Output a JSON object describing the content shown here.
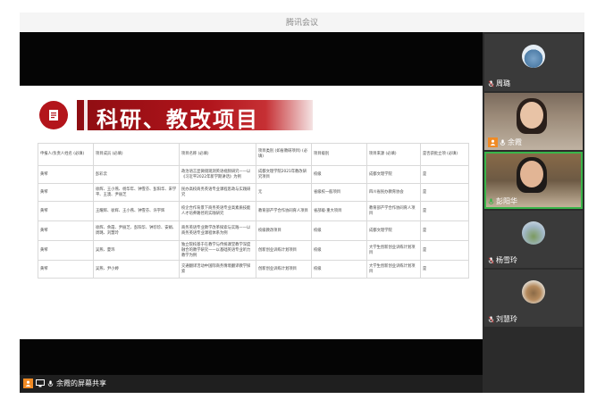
{
  "window": {
    "title": "腾讯会议"
  },
  "slide": {
    "title": "科研、教改项目",
    "table": {
      "headers": [
        "申报人/负责人姓名 (必填)",
        "项目成员 (必填)",
        "项目名称 (必填)",
        "项目类别 (如省教研项目) (必填)",
        "项目级别",
        "项目来源 (必填)",
        "是否获批立项 (必填)"
      ],
      "rows": [
        [
          "黄琴",
          "彭彩云",
          "政治语言显微镜观测英语视频研究——以《习近平2022年新学期讲话》为例",
          "成都文理学院2021年教改研究项目",
          "校级",
          "成都文理学院",
          "是"
        ],
        [
          "黄琴",
          "徐辉、王小燕、杨华年、钟雪芬、彭阳华、宋学平、王澳、尹丽芝",
          "民办高校商务英语专业课程思政与实践研究",
          "无",
          "省级校一般项目",
          "四川省民办教育协会",
          "是"
        ],
        [
          "黄琴",
          "王耀辉、徐辉、王小燕、钟雪芬、许宇辉",
          "校企合作背景下商务英语专业高素质技能人才培养路径的实践研究",
          "教育部产学合作协同育人项目",
          "省部级·重大项目",
          "教育部产学合作协同育人项目",
          "是"
        ],
        [
          "黄琴",
          "徐辉、余霞、尹丽芝、彭阳华、钟珍珍、安娟、周璐、刘慧玲",
          "商务英语专业教学改革探索与实践——以商务英语专业课程体系为例",
          "校级教改项目",
          "校级",
          "成都文理学院",
          "是"
        ],
        [
          "黄琴",
          "吴燕、夏玮",
          "独立院校基于在教学与传统课堂教学深度融合的教学研究——以基础英语专业听力教学为例",
          "创新创业训练计划项目",
          "校级",
          "大学生创新创业训练计划项目",
          "是"
        ],
        [
          "黄琴",
          "吴燕、尹小婷",
          "交通翻译活动中国际商务情境翻译教学探索",
          "创新创业训练计划项目",
          "校级",
          "大学生创新创业训练计划项目",
          "是"
        ]
      ]
    }
  },
  "participants": [
    {
      "name": "周璐"
    },
    {
      "name": "余霞"
    },
    {
      "name": "彭阳华"
    },
    {
      "name": "杨雪玲"
    },
    {
      "name": "刘慧玲"
    }
  ],
  "share_label": "余霞的屏幕共享",
  "colors": {
    "accent_red": "#b3151b",
    "speaking_green": "#39b54a",
    "host_orange": "#f08a24"
  },
  "icons": [
    "slide-logo-icon",
    "mic-icon",
    "screen-share-icon",
    "host-icon"
  ]
}
